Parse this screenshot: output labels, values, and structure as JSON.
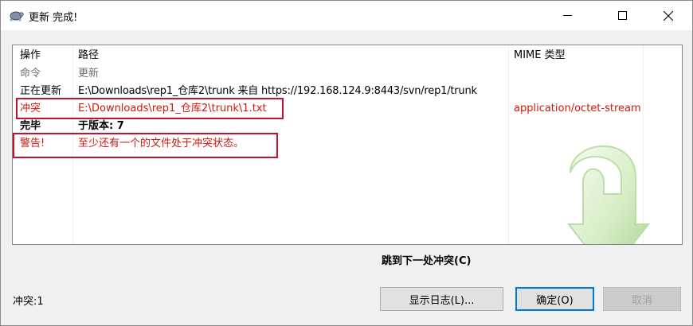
{
  "window": {
    "title": "更新 完成!",
    "minimize_icon": "minimize-icon",
    "maximize_icon": "maximize-icon",
    "close_icon": "close-icon"
  },
  "list": {
    "columns": {
      "action": "操作",
      "path": "路径",
      "mime": "MIME 类型"
    },
    "rows": [
      {
        "action": "命令",
        "path": "更新",
        "mime": "",
        "style": "gray"
      },
      {
        "action": "正在更新",
        "path": "E:\\Downloads\\rep1_仓库2\\trunk 来自 https://192.168.124.9:8443/svn/rep1/trunk",
        "mime": "",
        "style": "normal"
      },
      {
        "action": "冲突",
        "path": "E:\\Downloads\\rep1_仓库2\\trunk\\1.txt",
        "mime": "application/octet-stream",
        "style": "red"
      },
      {
        "action": "完毕",
        "path": "于版本: 7",
        "mime": "",
        "style": "bold"
      },
      {
        "action": "警告!",
        "path": "至少还有一个的文件处于冲突状态。",
        "mime": "",
        "style": "red"
      }
    ]
  },
  "next_conflict_label": "跳到下一处冲突(C)",
  "status_text": "冲突:1",
  "buttons": {
    "show_log": "显示日志(L)...",
    "ok": "确定(O)",
    "cancel": "取消"
  },
  "colors": {
    "highlight_box": "#c8102e",
    "conflict_text": "#d0180c",
    "default_button_border": "#0078d7"
  }
}
